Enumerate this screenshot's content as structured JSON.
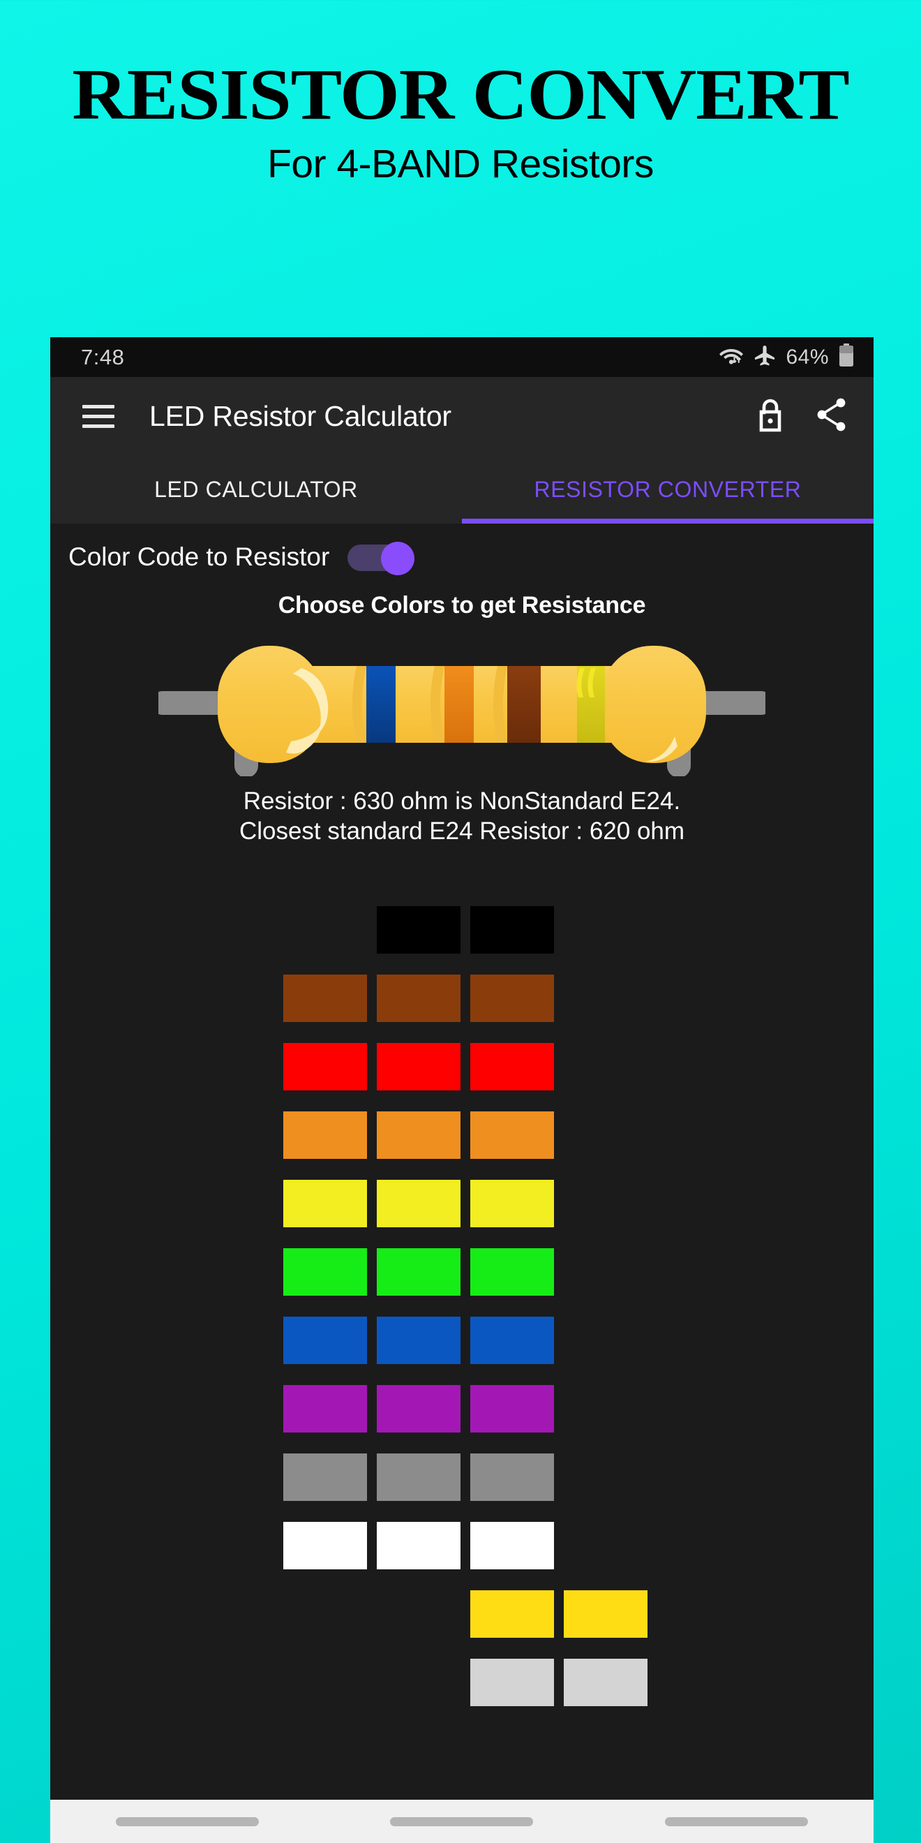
{
  "poster": {
    "title": "RESISTOR CONVERT",
    "subtitle": "For 4-BAND Resistors",
    "background_color": "#00efe4"
  },
  "status_bar": {
    "time": "7:48",
    "battery_percent": "64%",
    "icons": [
      "wifi-icon",
      "airplane-mode-icon",
      "battery-icon"
    ]
  },
  "app_bar": {
    "menu_icon": "hamburger-menu-icon",
    "title": "LED Resistor Calculator",
    "lock_icon": "unlock-icon",
    "share_icon": "share-icon"
  },
  "tabs": {
    "items": [
      {
        "label": "LED CALCULATOR",
        "active": false
      },
      {
        "label": "RESISTOR CONVERTER",
        "active": true
      }
    ],
    "active_color": "#7c4dff",
    "inactive_color": "#f2f2f2"
  },
  "toggle": {
    "label": "Color Code to Resistor",
    "state": "on",
    "thumb_color": "#8a4dfb",
    "track_color": "#4b3f6b"
  },
  "section": {
    "heading": "Choose Colors to get Resistance"
  },
  "resistor": {
    "body_color": "#f8c842",
    "lead_color": "#8a8a8a",
    "bands": [
      {
        "name": "band-1",
        "color_name": "Blue",
        "hex": "#0d47a1",
        "digit": "6"
      },
      {
        "name": "band-2",
        "color_name": "Orange",
        "hex": "#e8861e",
        "digit": "3"
      },
      {
        "name": "band-3",
        "color_name": "Brown",
        "hex": "#7a3a10",
        "multiplier": "x10"
      },
      {
        "name": "band-4",
        "color_name": "Gold",
        "hex": "#d6c81a",
        "tolerance": "5%"
      }
    ]
  },
  "result": {
    "line1": "Resistor : 630 ohm is NonStandard E24.",
    "line2": "Closest standard E24 Resistor : 620 ohm"
  },
  "color_grid": {
    "columns": 4,
    "rows": [
      {
        "name": "black",
        "hex": "#000000",
        "cells": [
          false,
          true,
          true,
          false
        ]
      },
      {
        "name": "brown",
        "hex": "#8a3d0b",
        "cells": [
          true,
          true,
          true,
          false
        ]
      },
      {
        "name": "red",
        "hex": "#fe0000",
        "cells": [
          true,
          true,
          true,
          false
        ]
      },
      {
        "name": "orange",
        "hex": "#ef8f20",
        "cells": [
          true,
          true,
          true,
          false
        ]
      },
      {
        "name": "yellow",
        "hex": "#f2ee21",
        "cells": [
          true,
          true,
          true,
          false
        ]
      },
      {
        "name": "green",
        "hex": "#16ed16",
        "cells": [
          true,
          true,
          true,
          false
        ]
      },
      {
        "name": "blue",
        "hex": "#0b57c2",
        "cells": [
          true,
          true,
          true,
          false
        ]
      },
      {
        "name": "violet",
        "hex": "#a318b5",
        "cells": [
          true,
          true,
          true,
          false
        ]
      },
      {
        "name": "gray",
        "hex": "#8c8c8c",
        "cells": [
          true,
          true,
          true,
          false
        ]
      },
      {
        "name": "white",
        "hex": "#ffffff",
        "cells": [
          true,
          true,
          true,
          false
        ]
      },
      {
        "name": "gold",
        "hex": "#ffdd15",
        "cells": [
          false,
          false,
          true,
          true
        ]
      },
      {
        "name": "silver",
        "hex": "#d4d4d4",
        "cells": [
          false,
          false,
          true,
          true
        ]
      }
    ]
  },
  "gesture_bar": {
    "pill_count": 3,
    "color": "#b5b5b5"
  }
}
